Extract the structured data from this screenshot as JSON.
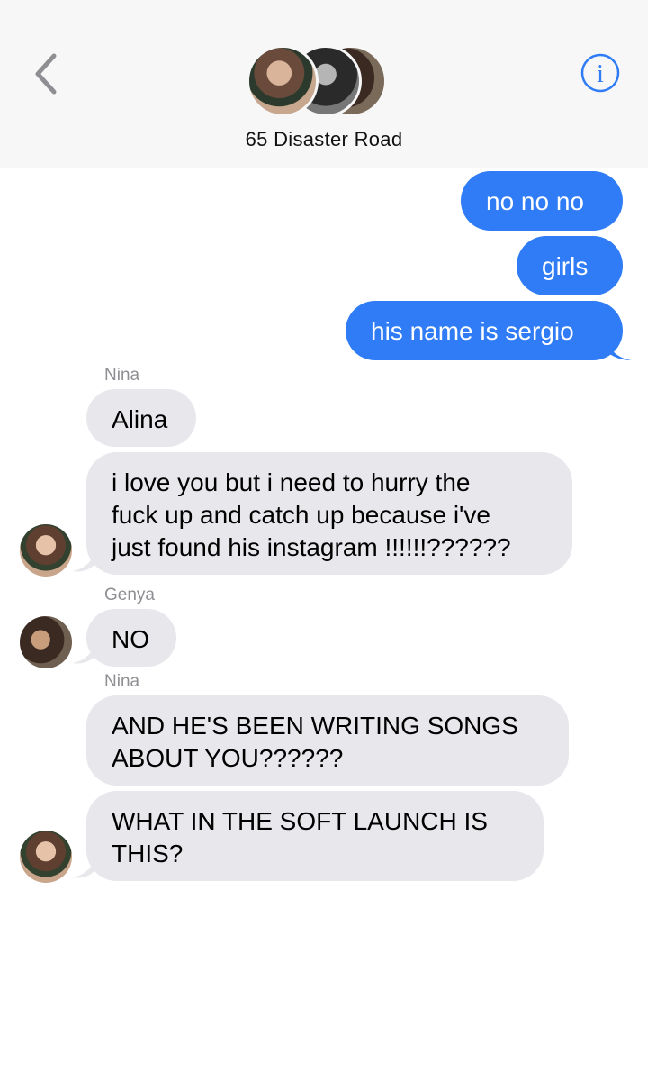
{
  "header": {
    "title": "65 Disaster Road",
    "back_icon": "chevron-left-icon",
    "info_icon": "info-icon",
    "info_glyph": "i",
    "accent_color": "#2f7cf6"
  },
  "messages": {
    "out": [
      "no no no",
      "girls",
      "his name is sergio"
    ],
    "senders": {
      "nina1": "Nina",
      "genya": "Genya",
      "nina2": "Nina"
    },
    "in": [
      "Alina",
      "i love you but i need to hurry the\nfuck up and catch up because i've\njust found his instagram !!!!!!??????",
      "NO",
      "AND HE'S BEEN WRITING SONGS\nABOUT YOU??????",
      "WHAT IN THE SOFT LAUNCH IS\nTHIS?"
    ]
  }
}
